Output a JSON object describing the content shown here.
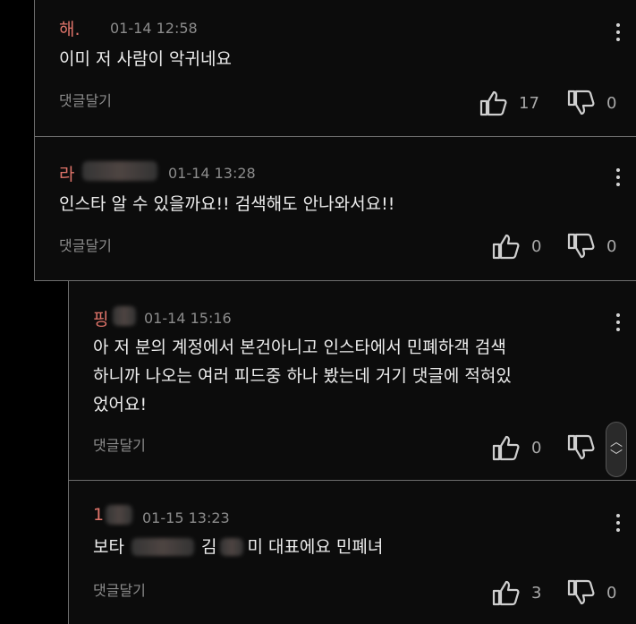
{
  "comments": [
    {
      "author": "해.",
      "time": "01-14 12:58",
      "text": "이미 저 사람이 악귀네요",
      "reply_label": "댓글달기",
      "likes": "17",
      "dislikes": "0"
    },
    {
      "author": "라",
      "time": "01-14 13:28",
      "text": "인스타 알 수 있을까요!! 검색해도 안나와서요!!",
      "reply_label": "댓글달기",
      "likes": "0",
      "dislikes": "0"
    },
    {
      "author": "핑",
      "time": "01-14 15:16",
      "text_lines": [
        "아 저 분의 계정에서 본건아니고 인스타에서 민폐하객 검색",
        "하니까 나오는 여러 피드중 하나 봤는데 거기 댓글에 적혀있",
        "었어요!"
      ],
      "reply_label": "댓글달기",
      "likes": "0",
      "dislikes": "0"
    },
    {
      "author": "1",
      "time": "01-15 13:23",
      "text_parts": [
        "보타",
        "김",
        "미 대표에요 민폐녀"
      ],
      "reply_label": "댓글달기",
      "likes": "3",
      "dislikes": "0"
    }
  ],
  "icons": {
    "like": "thumbs-up-icon",
    "dislike": "thumbs-down-icon",
    "more": "more-vertical-icon",
    "scroll": "scroll-up-down-icon"
  },
  "scroll_indicator": {
    "up": "︿",
    "down": "﹀"
  }
}
